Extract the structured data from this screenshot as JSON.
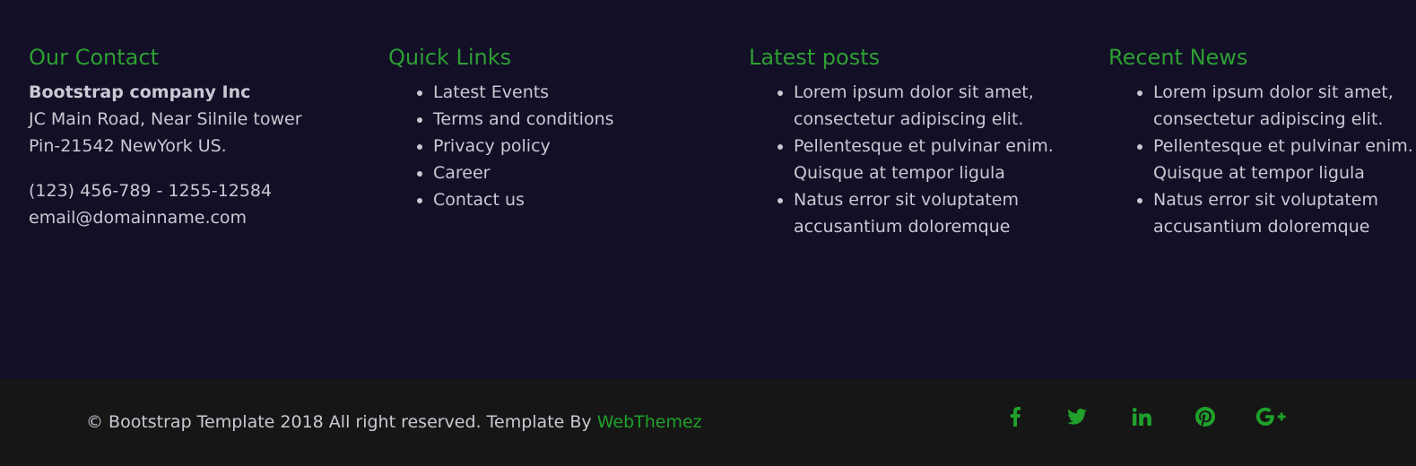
{
  "contact": {
    "heading": "Our Contact",
    "company": "Bootstrap company Inc",
    "address_line1": "JC Main Road, Near Silnile tower",
    "address_line2": "Pin-21542 NewYork US.",
    "phone": "(123) 456-789 - 1255-12584",
    "email": "email@domainname.com"
  },
  "quick_links": {
    "heading": "Quick Links",
    "items": [
      "Latest Events",
      "Terms and conditions",
      "Privacy policy",
      "Career",
      "Contact us"
    ]
  },
  "latest_posts": {
    "heading": "Latest posts",
    "items": [
      "Lorem ipsum dolor sit amet, consectetur adipiscing elit.",
      "Pellentesque et pulvinar enim. Quisque at tempor ligula",
      "Natus error sit voluptatem accusantium doloremque"
    ]
  },
  "recent_news": {
    "heading": "Recent News",
    "items": [
      "Lorem ipsum dolor sit amet, consectetur adipiscing elit.",
      "Pellentesque et pulvinar enim. Quisque at tempor ligula",
      "Natus error sit voluptatem accusantium doloremque"
    ]
  },
  "bottom": {
    "copyright_text": "© Bootstrap Template 2018 All right reserved. Template By ",
    "author_link": "WebThemez",
    "social": [
      {
        "icon": "facebook-icon"
      },
      {
        "icon": "twitter-icon"
      },
      {
        "icon": "linkedin-icon"
      },
      {
        "icon": "pinterest-icon"
      },
      {
        "icon": "google-plus-icon"
      }
    ]
  },
  "colors": {
    "background": "#120f27",
    "bottom_bar": "#171616",
    "accent": "#2e9e33",
    "text": "#c9c9d3"
  }
}
